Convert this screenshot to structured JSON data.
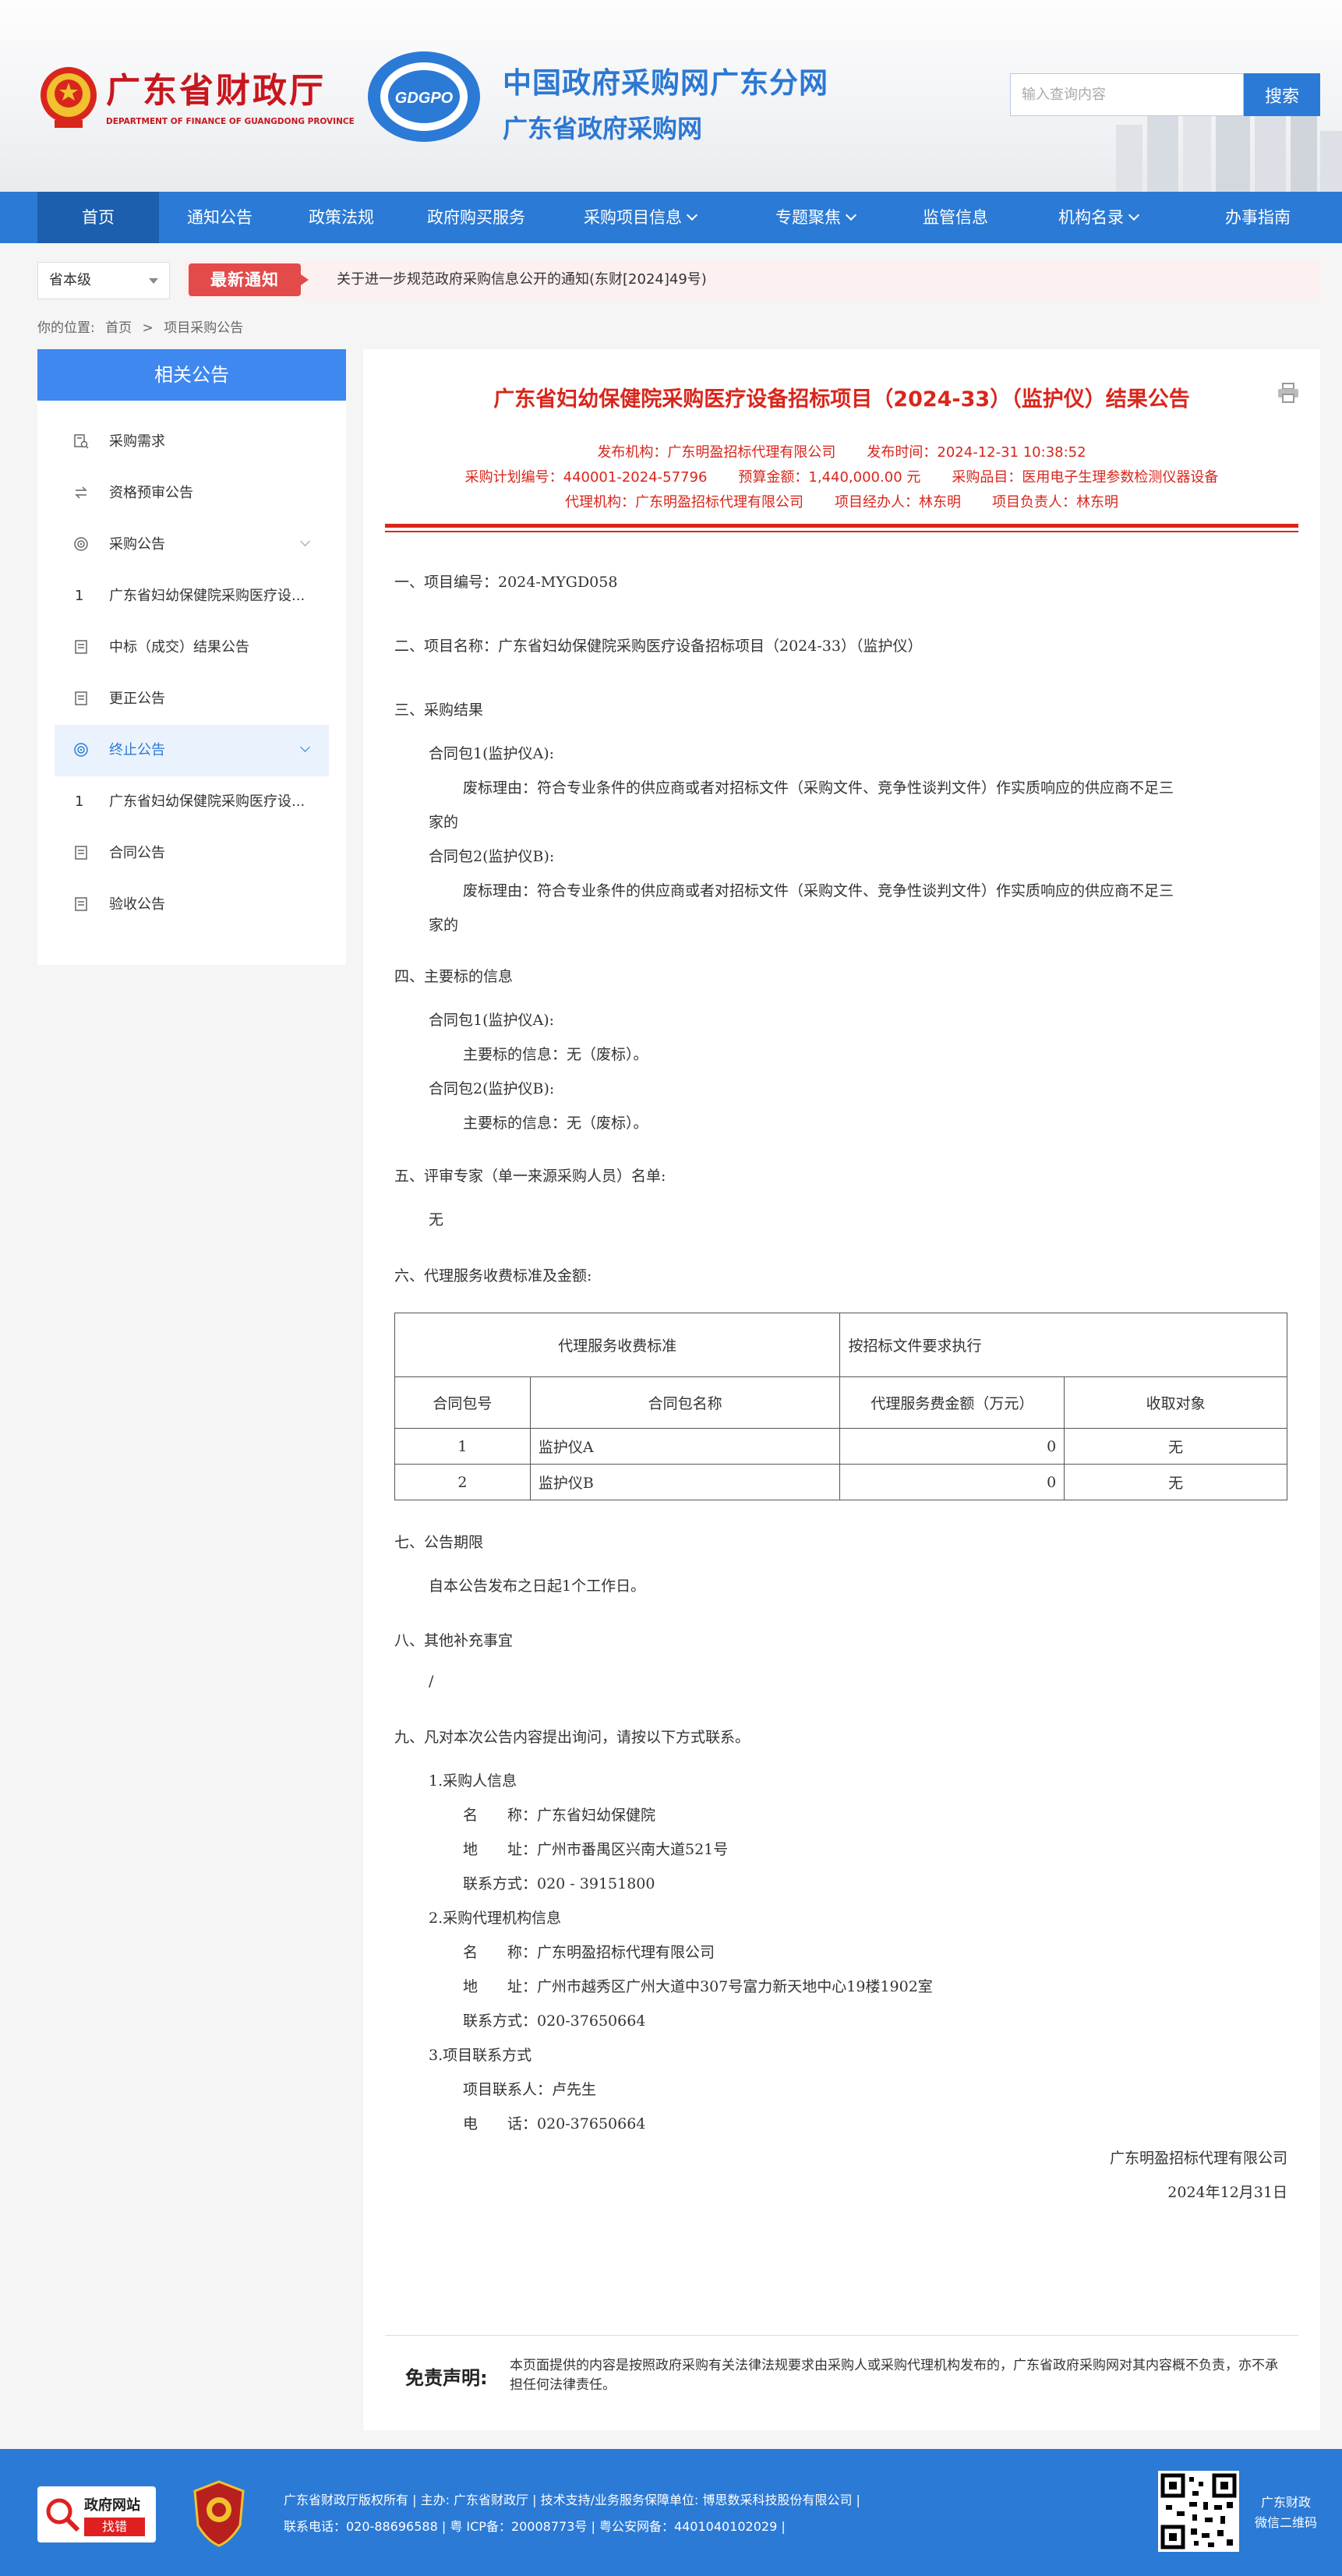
{
  "header": {
    "org_cn": "广东省财政厅",
    "org_en": "DEPARTMENT OF FINANCE OF GUANGDONG PROVINCE",
    "logo_text": "GDGPO",
    "site_name_1": "中国政府采购网广东分网",
    "site_name_2": "广东省政府采购网",
    "search_placeholder": "输入查询内容",
    "search_button": "搜索"
  },
  "nav": {
    "items": [
      {
        "label": "首页",
        "active": true
      },
      {
        "label": "通知公告"
      },
      {
        "label": "政策法规"
      },
      {
        "label": "政府购买服务"
      },
      {
        "label": "采购项目信息",
        "dropdown": true
      },
      {
        "label": "专题聚焦",
        "dropdown": true
      },
      {
        "label": "监管信息"
      },
      {
        "label": "机构名录",
        "dropdown": true
      },
      {
        "label": "办事指南"
      }
    ]
  },
  "notice": {
    "level": "省本级",
    "badge": "最新通知",
    "text": "关于进一步规范政府采购信息公开的通知(东财[2024]49号)"
  },
  "breadcrumb": {
    "prefix": "你的位置:",
    "items": [
      "首页",
      ">",
      "项目采购公告"
    ]
  },
  "sidebar": {
    "title": "相关公告",
    "items": [
      {
        "label": "采购需求",
        "icon": "doc-search-icon"
      },
      {
        "label": "资格预审公告",
        "icon": "swap-icon"
      },
      {
        "label": "采购公告",
        "icon": "target-icon",
        "chevron": true
      },
      {
        "label": "广东省妇幼保健院采购医疗设...",
        "num": "1"
      },
      {
        "label": "中标（成交）结果公告",
        "icon": "doc-icon"
      },
      {
        "label": "更正公告",
        "icon": "doc-icon"
      },
      {
        "label": "终止公告",
        "icon": "target-icon",
        "chevron": true,
        "active": true
      },
      {
        "label": "广东省妇幼保健院采购医疗设...",
        "num": "1"
      },
      {
        "label": "合同公告",
        "icon": "doc-icon"
      },
      {
        "label": "验收公告",
        "icon": "doc-icon"
      }
    ]
  },
  "article": {
    "title": "广东省妇幼保健院采购医疗设备招标项目（2024-33）（监护仪）结果公告",
    "meta1": [
      "发布机构：广东明盈招标代理有限公司",
      "发布时间：2024-12-31 10:38:52"
    ],
    "meta2": [
      "采购计划编号：440001-2024-57796",
      "预算金额：1,440,000.00 元",
      "采购品目：医用电子生理参数检测仪器设备"
    ],
    "meta3": [
      "代理机构：广东明盈招标代理有限公司",
      "项目经办人：林东明",
      "项目负责人：林东明"
    ],
    "s1": "一、项目编号：2024-MYGD058",
    "s2": "二、项目名称：广东省妇幼保健院采购医疗设备招标项目（2024-33）（监护仪）",
    "s3": "三、采购结果",
    "s3_p1": "合同包1(监护仪A):",
    "s3_p1_r1": "废标理由：符合专业条件的供应商或者对招标文件（采购文件、竞争性谈判文件）作实质响应的供应商不足三",
    "s3_p1_r2": "家的",
    "s3_p2": "合同包2(监护仪B):",
    "s3_p2_r1": "废标理由：符合专业条件的供应商或者对招标文件（采购文件、竞争性谈判文件）作实质响应的供应商不足三",
    "s3_p2_r2": "家的",
    "s4": "四、主要标的信息",
    "s4_p1": "合同包1(监护仪A):",
    "s4_p1_r": "主要标的信息：无（废标）。",
    "s4_p2": "合同包2(监护仪B):",
    "s4_p2_r": "主要标的信息：无（废标）。",
    "s5": "五、评审专家（单一来源采购人员）名单:",
    "s5_v": "无",
    "s6": "六、代理服务收费标准及金额:",
    "fee_table": {
      "std_label": "代理服务收费标准",
      "std_value": "按招标文件要求执行",
      "headers": [
        "合同包号",
        "合同包名称",
        "代理服务费金额（万元）",
        "收取对象"
      ],
      "rows": [
        [
          "1",
          "监护仪A",
          "0",
          "无"
        ],
        [
          "2",
          "监护仪B",
          "0",
          "无"
        ]
      ]
    },
    "s7": "七、公告期限",
    "s7_v": "自本公告发布之日起1个工作日。",
    "s8": "八、其他补充事宜",
    "s8_v": "/",
    "s9": "九、凡对本次公告内容提出询问，请按以下方式联系。",
    "c1": "1.采购人信息",
    "c1_name": "名　　称：广东省妇幼保健院",
    "c1_addr": "地　　址：广州市番禺区兴南大道521号",
    "c1_tel": "联系方式：020 - 39151800",
    "c2": "2.采购代理机构信息",
    "c2_name": "名　　称：广东明盈招标代理有限公司",
    "c2_addr": "地　　址：广州市越秀区广州大道中307号富力新天地中心19楼1902室",
    "c2_tel": "联系方式：020-37650664",
    "c3": "3.项目联系方式",
    "c3_person": "项目联系人：卢先生",
    "c3_tel": "电　　话：020-37650664",
    "sign_org": "广东明盈招标代理有限公司",
    "sign_date": "2024年12月31日"
  },
  "disclaimer": {
    "title": "免责声明:",
    "text": "本页面提供的内容是按照政府采购有关法律法规要求由采购人或采购代理机构发布的，广东省政府采购网对其内容概不负责，亦不承担任何法律责任。"
  },
  "footer": {
    "gov_badge_title": "政府网站",
    "gov_badge_btn": "找错",
    "line1": "广东省财政厅版权所有 | 主办: 广东省财政厅 | 技术支持/业务服务保障单位: 博思数采科技股份有限公司 |",
    "line2": "联系电话：020-88696588 | 粤 ICP备：20008773号 | 粤公安网备：44010401020​29 |",
    "qr_label_1": "广东财政",
    "qr_label_2": "微信二维码"
  },
  "colors": {
    "brand_blue": "#2b7ad6",
    "nav_active": "#1b5fae",
    "title_red": "#d9261c",
    "badge_red": "#e34a4a"
  }
}
